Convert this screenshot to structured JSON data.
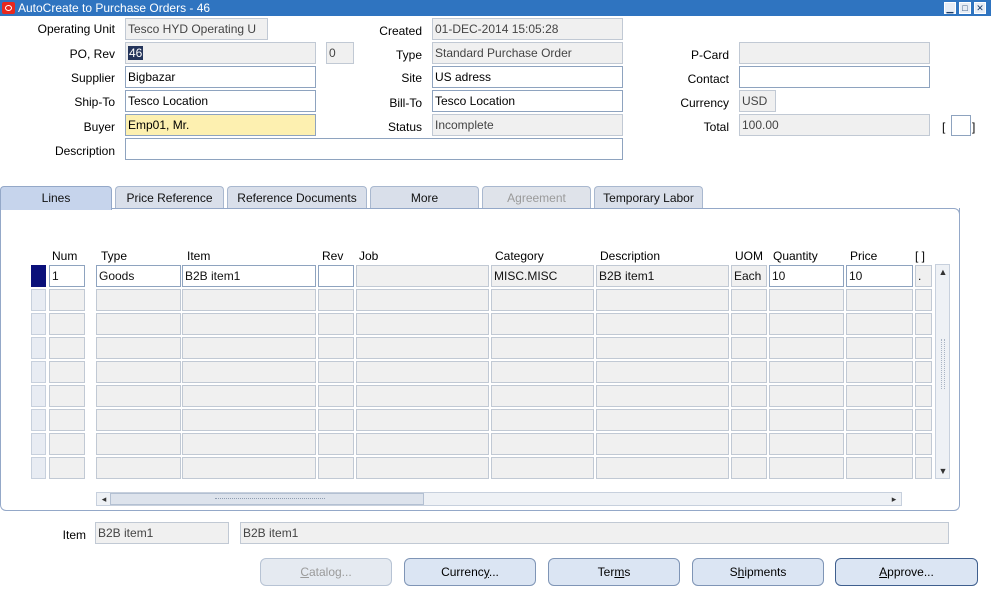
{
  "window": {
    "title": "AutoCreate to Purchase Orders - 46"
  },
  "header": {
    "operating_unit_label": "Operating Unit",
    "operating_unit_value": "Tesco HYD Operating U",
    "po_rev_label": "PO, Rev",
    "po_number": "46",
    "revision": "0",
    "supplier_label": "Supplier",
    "supplier_value": "Bigbazar",
    "ship_to_label": "Ship-To",
    "ship_to_value": "Tesco Location",
    "buyer_label": "Buyer",
    "buyer_value": "Emp01, Mr.",
    "description_label": "Description",
    "description_value": "",
    "created_label": "Created",
    "created_value": "01-DEC-2014 15:05:28",
    "type_label": "Type",
    "type_value": "Standard Purchase Order",
    "site_label": "Site",
    "site_value": "US adress",
    "bill_to_label": "Bill-To",
    "bill_to_value": "Tesco Location",
    "status_label": "Status",
    "status_value": "Incomplete",
    "pcard_label": "P-Card",
    "pcard_value": "",
    "contact_label": "Contact",
    "contact_value": "",
    "currency_label": "Currency",
    "currency_value": "USD",
    "total_label": "Total",
    "total_value": "100.00",
    "flex_open": "[",
    "flex_close": "]"
  },
  "tabs": [
    {
      "label": "Lines",
      "active": true,
      "disabled": false
    },
    {
      "label": "Price Reference",
      "active": false,
      "disabled": false
    },
    {
      "label": "Reference Documents",
      "active": false,
      "disabled": false
    },
    {
      "label": "More",
      "active": false,
      "disabled": false
    },
    {
      "label": "Agreement",
      "active": false,
      "disabled": true
    },
    {
      "label": "Temporary Labor",
      "active": false,
      "disabled": false
    }
  ],
  "lines": {
    "columns": {
      "num": "Num",
      "type": "Type",
      "item": "Item",
      "rev": "Rev",
      "job": "Job",
      "category": "Category",
      "description": "Description",
      "uom": "UOM",
      "quantity": "Quantity",
      "price": "Price",
      "flex": "[ ]"
    },
    "rows": [
      {
        "num": "1",
        "type": "Goods",
        "item": "B2B item1",
        "rev": "",
        "job": "",
        "category": "MISC.MISC",
        "description": "B2B item1",
        "uom": "Each",
        "quantity": "10",
        "price": "10",
        "flex": "."
      }
    ],
    "empty_row_count": 8
  },
  "footer": {
    "item_label": "Item",
    "item_value": "B2B item1",
    "item_description": "B2B item1"
  },
  "buttons": {
    "catalog": {
      "pre": "",
      "ul": "C",
      "post": "atalog...",
      "enabled": false
    },
    "currency": {
      "pre": "Currenc",
      "ul": "y",
      "post": "...",
      "enabled": true
    },
    "terms": {
      "pre": "Ter",
      "ul": "m",
      "post": "s",
      "enabled": true
    },
    "shipments": {
      "pre": "S",
      "ul": "h",
      "post": "ipments",
      "enabled": true
    },
    "approve": {
      "pre": "",
      "ul": "A",
      "post": "pprove...",
      "enabled": true
    }
  },
  "icons": {
    "app_icon": "oracle-icon",
    "minimize": "minimize-icon",
    "maximize": "maximize-icon",
    "close": "close-icon",
    "scroll_up": "scroll-up-arrow-icon",
    "scroll_down": "scroll-down-arrow-icon",
    "scroll_left": "scroll-left-arrow-icon",
    "scroll_right": "scroll-right-arrow-icon"
  },
  "colors": {
    "titlebar": "#2f74c0",
    "required_field": "#fdf0b0",
    "current_record": "#0a107a",
    "active_tab": "#c6d4ec"
  }
}
